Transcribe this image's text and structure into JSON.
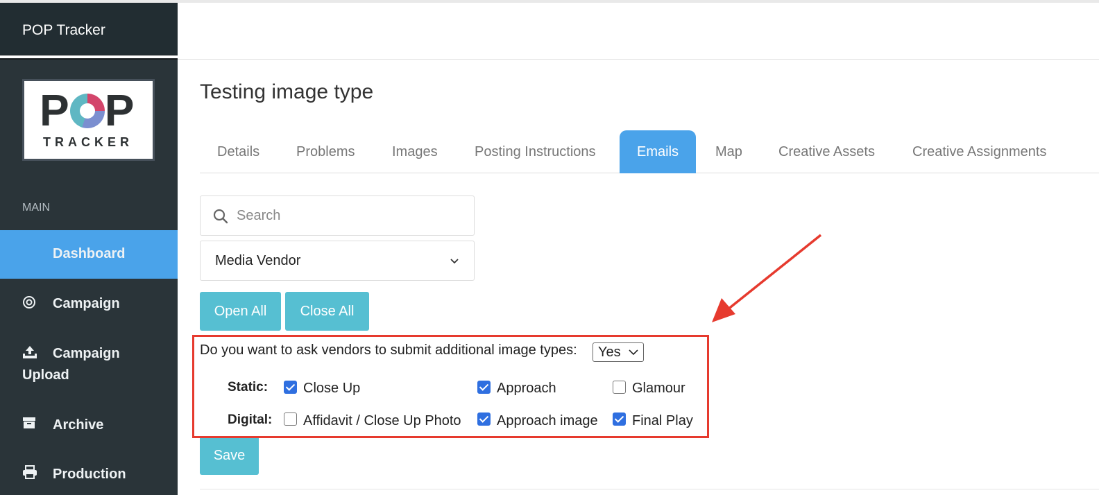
{
  "app": {
    "brand": "POP Tracker"
  },
  "logo": {
    "pop_text_left": "P",
    "pop_text_right": "P",
    "tracker_text": "TRACKER"
  },
  "sidebar": {
    "section_label": "MAIN",
    "items": [
      {
        "label": "Dashboard",
        "icon": "",
        "active": true
      },
      {
        "label": "Campaign",
        "icon": "target-icon",
        "active": false
      },
      {
        "label": "Campaign\nUpload",
        "icon": "upload-icon",
        "active": false
      },
      {
        "label": "Archive",
        "icon": "archive-icon",
        "active": false
      },
      {
        "label": "Production",
        "icon": "printer-icon",
        "active": false
      }
    ]
  },
  "main": {
    "title": "Testing image type",
    "tabs": [
      {
        "label": "Details",
        "active": false
      },
      {
        "label": "Problems",
        "active": false
      },
      {
        "label": "Images",
        "active": false
      },
      {
        "label": "Posting Instructions",
        "active": false
      },
      {
        "label": "Emails",
        "active": true
      },
      {
        "label": "Map",
        "active": false
      },
      {
        "label": "Creative Assets",
        "active": false
      },
      {
        "label": "Creative Assignments",
        "active": false
      }
    ],
    "search": {
      "placeholder": "Search",
      "value": ""
    },
    "vendor_select": {
      "value": "Media Vendor"
    },
    "buttons": {
      "open_all": "Open All",
      "close_all": "Close All",
      "save": "Save"
    },
    "image_types": {
      "question": "Do you want to ask vendors to submit additional image types:",
      "answer": "Yes",
      "static_label": "Static:",
      "digital_label": "Digital:",
      "static": [
        {
          "label": "Close Up",
          "checked": true
        },
        {
          "label": "Approach",
          "checked": true
        },
        {
          "label": "Glamour",
          "checked": false
        }
      ],
      "digital": [
        {
          "label": "Affidavit / Close Up Photo",
          "checked": false
        },
        {
          "label": "Approach image",
          "checked": true
        },
        {
          "label": "Final Play",
          "checked": true
        }
      ]
    }
  },
  "colors": {
    "sidebar_bg": "#2a3439",
    "accent_blue": "#4aa3ea",
    "button_teal": "#56bfd2",
    "checkbox_blue": "#2f6fe0",
    "annotation_red": "#e63a2e"
  }
}
